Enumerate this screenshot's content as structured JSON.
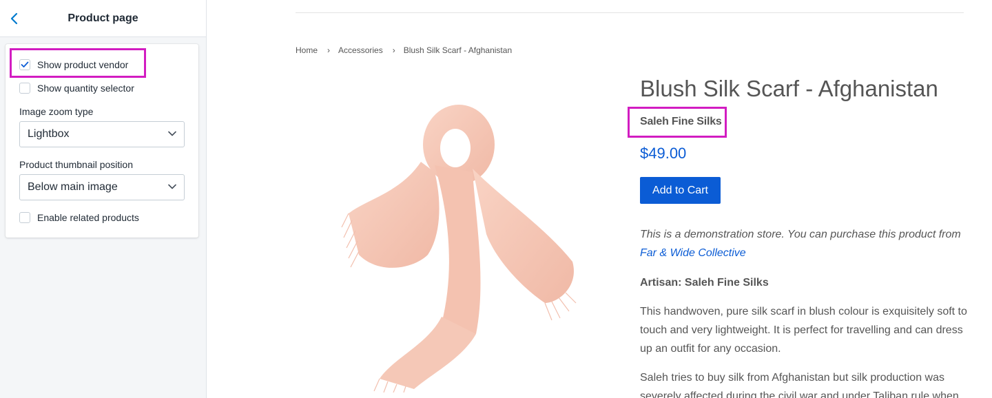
{
  "sidebar": {
    "title": "Product page",
    "settings": {
      "show_vendor": {
        "label": "Show product vendor",
        "checked": true
      },
      "show_quantity": {
        "label": "Show quantity selector",
        "checked": false
      },
      "zoom": {
        "label": "Image zoom type",
        "value": "Lightbox"
      },
      "thumb": {
        "label": "Product thumbnail position",
        "value": "Below main image"
      },
      "related": {
        "label": "Enable related products",
        "checked": false
      }
    }
  },
  "preview": {
    "breadcrumb": {
      "items": [
        "Home",
        "Accessories",
        "Blush Silk Scarf - Afghanistan"
      ],
      "separator": "›"
    },
    "product": {
      "title": "Blush Silk Scarf - Afghanistan",
      "vendor": "Saleh Fine Silks",
      "price": "$49.00",
      "add_to_cart": "Add to Cart",
      "demo_note": "This is a demonstration store. You can purchase this product from",
      "demo_link": "Far & Wide Collective",
      "artisan": "Artisan: Saleh Fine Silks",
      "paragraph1": "This handwoven, pure silk scarf in blush colour is exquisitely soft to touch and very lightweight. It is perfect for travelling and can dress up an outfit for any occasion.",
      "paragraph2": "Saleh tries to buy silk from Afghanistan but silk production was severely affected during the civil war and under Taliban rule when"
    }
  },
  "colors": {
    "highlight": "#d21cc1",
    "accent_blue": "#0b5cd5",
    "back_arrow": "#007ace",
    "scarf": "#f6c6b5"
  }
}
